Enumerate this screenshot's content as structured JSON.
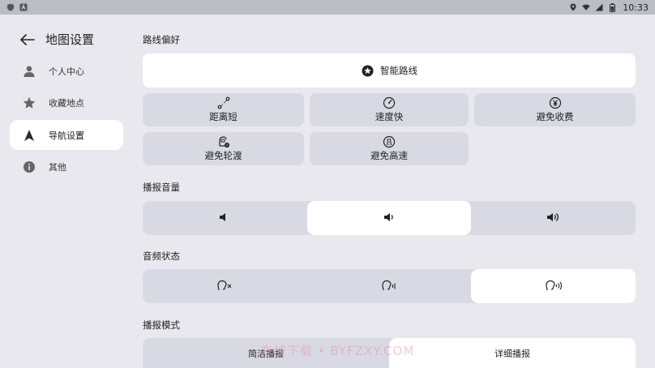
{
  "status_bar": {
    "time": "10:33",
    "left_icons": [
      "shield-icon",
      "app-a-icon"
    ],
    "right_icons": [
      "location-icon",
      "wifi-icon",
      "signal-icon",
      "battery-icon"
    ]
  },
  "sidebar": {
    "title": "地图设置",
    "items": [
      {
        "label": "个人中心",
        "icon": "person-icon",
        "active": false
      },
      {
        "label": "收藏地点",
        "icon": "star-icon",
        "active": false
      },
      {
        "label": "导航设置",
        "icon": "navigation-arrow-icon",
        "active": true
      },
      {
        "label": "其他",
        "icon": "info-icon",
        "active": false
      }
    ]
  },
  "route_pref": {
    "title": "路线偏好",
    "smart": "智能路线",
    "options": [
      {
        "label": "距离短",
        "icon": "route-icon"
      },
      {
        "label": "速度快",
        "icon": "speedometer-icon"
      },
      {
        "label": "避免收费",
        "icon": "yen-icon"
      },
      {
        "label": "避免轮渡",
        "icon": "ferry-icon"
      },
      {
        "label": "避免高速",
        "icon": "highway-icon"
      }
    ]
  },
  "volume": {
    "title": "播报音量",
    "options": [
      "volume-low-icon",
      "volume-medium-icon",
      "volume-high-icon"
    ],
    "selected_index": 1
  },
  "audio_state": {
    "title": "音频状态",
    "options": [
      "voice-mute-icon",
      "voice-low-icon",
      "voice-full-icon"
    ],
    "selected_index": 2
  },
  "broadcast_mode": {
    "title": "播报模式",
    "options": [
      "简洁播报",
      "详细播报"
    ],
    "selected_index": 1
  },
  "watermark": "东坡下载 • BYFZXY.COM",
  "colors": {
    "background": "#e8e8ee",
    "button": "#d8d9e3",
    "selected": "#ffffff",
    "status_bar": "#bcbcc4"
  }
}
